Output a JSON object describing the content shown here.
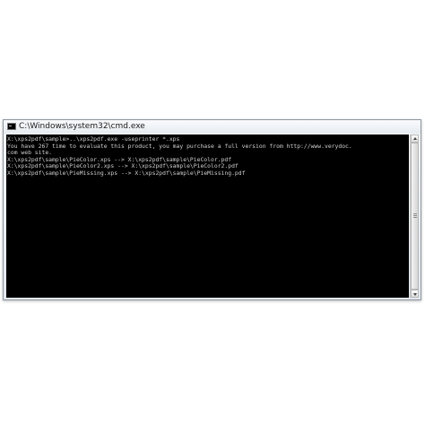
{
  "window": {
    "title": "C:\\Windows\\system32\\cmd.exe",
    "icon": "console-icon"
  },
  "console": {
    "lines": [
      "X:\\xps2pdf\\sample>..\\xps2pdf.exe -useprinter *.xps",
      "You have 267 time to evaluate this product, you may purchase a full version from http://www.verydoc.",
      "com web site.",
      "X:\\xps2pdf\\sample\\PieColor.xps --> X:\\xps2pdf\\sample\\PieColor.pdf",
      "X:\\xps2pdf\\sample\\PieColor2.xps --> X:\\xps2pdf\\sample\\PieColor2.pdf",
      "X:\\xps2pdf\\sample\\PieMissing.xps --> X:\\xps2pdf\\sample\\PieMissing.pdf"
    ],
    "text_color": "#d0d0d0",
    "background_color": "#000000"
  }
}
